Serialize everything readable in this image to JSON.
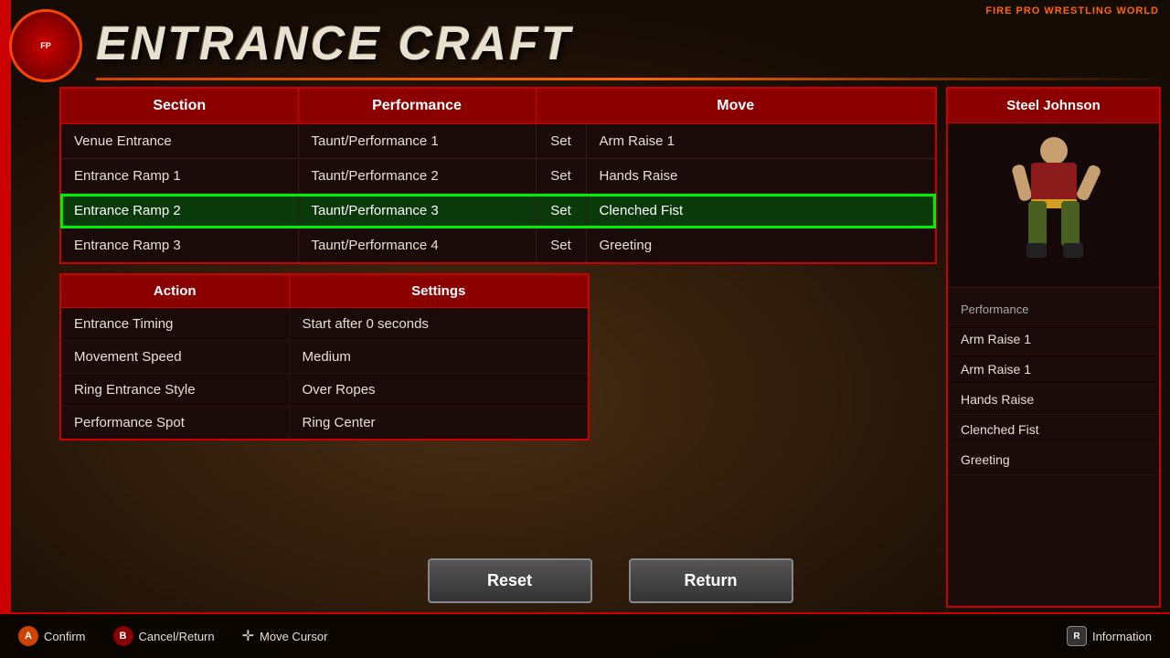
{
  "game": {
    "title": "FIRE PRO WRESTLING WORLD",
    "screen_title": "ENTRANCE CRAFT"
  },
  "main_table": {
    "headers": [
      "Section",
      "Performance",
      "Move"
    ],
    "move_subheaders": [
      "",
      "Set",
      ""
    ],
    "rows": [
      {
        "section": "Venue Entrance",
        "performance": "Taunt/Performance 1",
        "set": "Set",
        "move": "Arm Raise 1",
        "selected": false
      },
      {
        "section": "Entrance Ramp 1",
        "performance": "Taunt/Performance 2",
        "set": "Set",
        "move": "Hands Raise",
        "selected": false
      },
      {
        "section": "Entrance Ramp 2",
        "performance": "Taunt/Performance 3",
        "set": "Set",
        "move": "Clenched Fist",
        "selected": true
      },
      {
        "section": "Entrance Ramp 3",
        "performance": "Taunt/Performance 4",
        "set": "Set",
        "move": "Greeting",
        "selected": false
      }
    ]
  },
  "settings_table": {
    "headers": [
      "Action",
      "Settings"
    ],
    "rows": [
      {
        "action": "Entrance Timing",
        "setting": "Start after 0 seconds"
      },
      {
        "action": "Movement Speed",
        "setting": "Medium"
      },
      {
        "action": "Ring Entrance Style",
        "setting": "Over Ropes"
      },
      {
        "action": "Performance Spot",
        "setting": "Ring Center"
      }
    ]
  },
  "right_panel": {
    "title": "Steel Johnson",
    "list_header": "Performance",
    "list_items": [
      "Arm Raise 1",
      "Arm Raise 1",
      "Hands Raise",
      "Clenched Fist",
      "Greeting"
    ]
  },
  "buttons": {
    "reset": "Reset",
    "return": "Return"
  },
  "bottom_bar": {
    "controls": [
      {
        "key": "A",
        "label": "Confirm",
        "type": "circle"
      },
      {
        "key": "B",
        "label": "Cancel/Return",
        "type": "circle"
      },
      {
        "key": "✛",
        "label": "Move Cursor",
        "type": "dpad"
      },
      {
        "key": "R",
        "label": "Information",
        "type": "rect",
        "align": "right"
      }
    ]
  },
  "logo": {
    "text": "FIRE\nPRO",
    "abbr": "FP"
  }
}
